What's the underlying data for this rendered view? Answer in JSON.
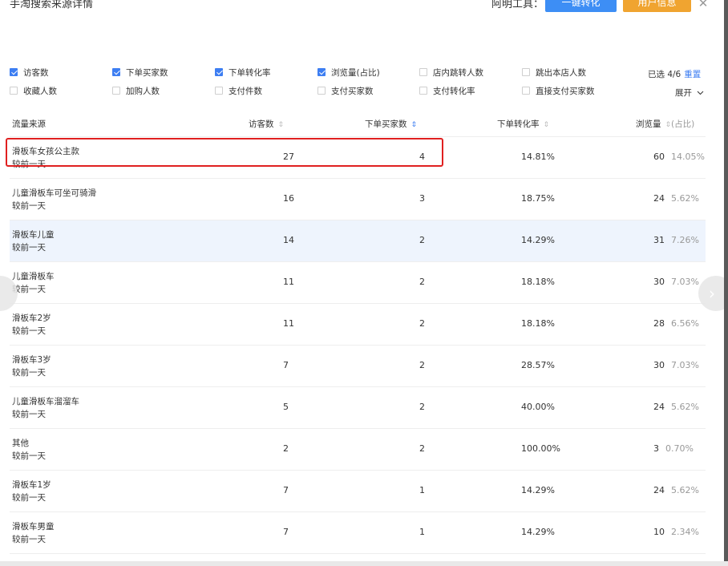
{
  "header": {
    "title": "手淘搜索来源详情",
    "tool_label": "阿明工具：",
    "convert_button": "一键转化",
    "user_button": "用户信息",
    "close_glyph": "✕",
    "colors": {
      "convert_bg": "#3d8ef5",
      "user_bg": "#f0a430",
      "accent": "#3d7ef2",
      "highlight_box": "#e02020"
    }
  },
  "filters": {
    "row1": [
      {
        "label": "访客数",
        "checked": true
      },
      {
        "label": "下单买家数",
        "checked": true
      },
      {
        "label": "下单转化率",
        "checked": true
      },
      {
        "label": "浏览量(占比)",
        "checked": true
      },
      {
        "label": "店内跳转人数",
        "checked": false
      },
      {
        "label": "跳出本店人数",
        "checked": false
      }
    ],
    "row2": [
      {
        "label": "收藏人数",
        "checked": false
      },
      {
        "label": "加购人数",
        "checked": false
      },
      {
        "label": "支付件数",
        "checked": false
      },
      {
        "label": "支付买家数",
        "checked": false
      },
      {
        "label": "支付转化率",
        "checked": false
      },
      {
        "label": "直接支付买家数",
        "checked": false
      }
    ],
    "selected": "已选 4/6",
    "reset": "重置",
    "expand": "展开",
    "expand_icon": "chevron-down-icon"
  },
  "table": {
    "columns": [
      "流量来源",
      "访客数",
      "下单买家数",
      "下单转化率",
      "浏览量",
      "(占比)"
    ],
    "sort_glyph": "⇕",
    "rows": [
      {
        "name": "滑板车女孩公主款",
        "sub": "较前一天",
        "visitors": "27",
        "buyers": "4",
        "rate": "14.81%",
        "views": "60",
        "share": "14.05%"
      },
      {
        "name": "儿童滑板车可坐可骑滑",
        "sub": "较前一天",
        "visitors": "16",
        "buyers": "3",
        "rate": "18.75%",
        "views": "24",
        "share": "5.62%"
      },
      {
        "name": "滑板车儿童",
        "sub": "较前一天",
        "visitors": "14",
        "buyers": "2",
        "rate": "14.29%",
        "views": "31",
        "share": "7.26%"
      },
      {
        "name": "儿童滑板车",
        "sub": "较前一天",
        "visitors": "11",
        "buyers": "2",
        "rate": "18.18%",
        "views": "30",
        "share": "7.03%"
      },
      {
        "name": "滑板车2岁",
        "sub": "较前一天",
        "visitors": "11",
        "buyers": "2",
        "rate": "18.18%",
        "views": "28",
        "share": "6.56%"
      },
      {
        "name": "滑板车3岁",
        "sub": "较前一天",
        "visitors": "7",
        "buyers": "2",
        "rate": "28.57%",
        "views": "30",
        "share": "7.03%"
      },
      {
        "name": "儿童滑板车溜溜车",
        "sub": "较前一天",
        "visitors": "5",
        "buyers": "2",
        "rate": "40.00%",
        "views": "24",
        "share": "5.62%"
      },
      {
        "name": "其他",
        "sub": "较前一天",
        "visitors": "2",
        "buyers": "2",
        "rate": "100.00%",
        "views": "3",
        "share": "0.70%"
      },
      {
        "name": "滑板车1岁",
        "sub": "较前一天",
        "visitors": "7",
        "buyers": "1",
        "rate": "14.29%",
        "views": "24",
        "share": "5.62%"
      },
      {
        "name": "滑板车男童",
        "sub": "较前一天",
        "visitors": "7",
        "buyers": "1",
        "rate": "14.29%",
        "views": "10",
        "share": "2.34%"
      }
    ]
  },
  "nav": {
    "next_glyph": "›"
  }
}
